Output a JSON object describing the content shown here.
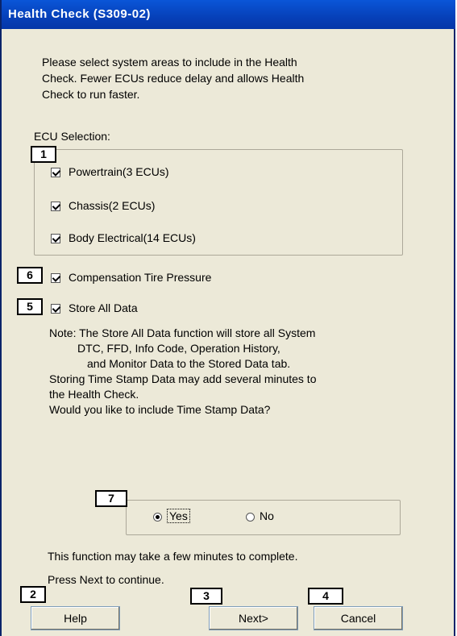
{
  "window": {
    "title": "Health Check (S309-02)"
  },
  "intro": {
    "line1": "Please select system areas to include in the Health",
    "line2": "Check. Fewer ECUs reduce delay and allows Health",
    "line3": "Check to run faster."
  },
  "ecu_selection": {
    "label": "ECU Selection:",
    "items": [
      {
        "label": "Powertrain(3 ECUs)",
        "checked": true
      },
      {
        "label": "Chassis(2 ECUs)",
        "checked": true
      },
      {
        "label": "Body Electrical(14 ECUs)",
        "checked": true
      }
    ]
  },
  "compensation": {
    "label": "Compensation Tire Pressure",
    "checked": true
  },
  "store_all": {
    "label": "Store All Data",
    "checked": true
  },
  "note": {
    "line1": "Note: The Store All Data function will store all System",
    "line2": "DTC, FFD, Info Code, Operation History,",
    "line3": "and Monitor Data to the Stored Data tab.",
    "line4": "Storing Time Stamp Data may add several minutes to",
    "line5": "the Health Check.",
    "line6": "Would you like to include Time Stamp Data?"
  },
  "timestamp_choice": {
    "yes_label": "Yes",
    "no_label": "No",
    "selected": "Yes"
  },
  "footer": {
    "line1": "This function may take a few minutes to complete.",
    "line2": "Press Next to continue."
  },
  "buttons": {
    "help": "Help",
    "next": "Next>",
    "cancel": "Cancel"
  },
  "callouts": {
    "c1": "1",
    "c2": "2",
    "c3": "3",
    "c4": "4",
    "c5": "5",
    "c6": "6",
    "c7": "7"
  }
}
